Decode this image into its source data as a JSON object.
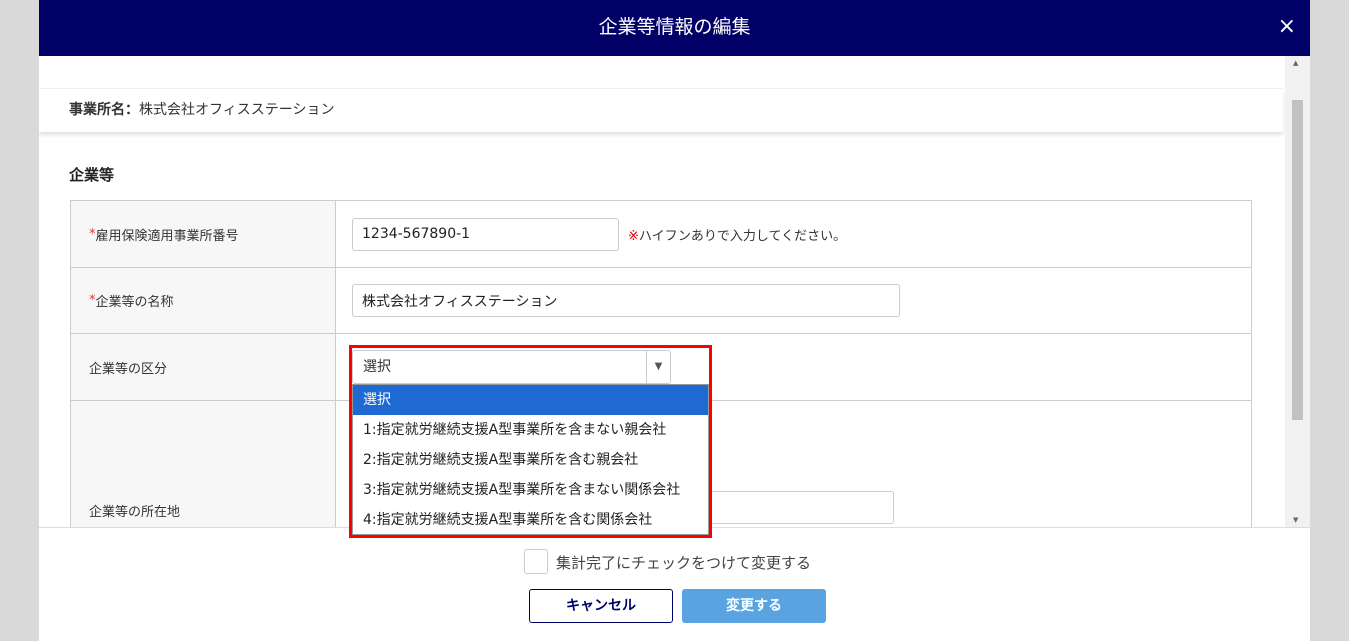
{
  "modal": {
    "title": "企業等情報の編集",
    "close": "×"
  },
  "office": {
    "label": "事業所名：",
    "value": "株式会社オフィスステーション"
  },
  "section": "企業等",
  "fields": {
    "insurance_no": {
      "required": "*",
      "label": "雇用保険適用事業所番号",
      "value": "1234-567890-1",
      "note_mark": "※",
      "note": "ハイフンありで入力してください。"
    },
    "name": {
      "required": "*",
      "label": "企業等の名称",
      "value": "株式会社オフィスステーション"
    },
    "category": {
      "label": "企業等の区分",
      "value": "選択",
      "options": [
        "選択",
        "1:指定就労継続支援A型事業所を含まない親会社",
        "2:指定就労継続支援A型事業所を含む親会社",
        "3:指定就労継続支援A型事業所を含まない関係会社",
        "4:指定就労継続支援A型事業所を含む関係会社"
      ]
    },
    "address": {
      "label": "企業等の所在地"
    }
  },
  "footer": {
    "checkbox_label": "集計完了にチェックをつけて変更する",
    "cancel": "キャンセル",
    "submit": "変更する"
  }
}
